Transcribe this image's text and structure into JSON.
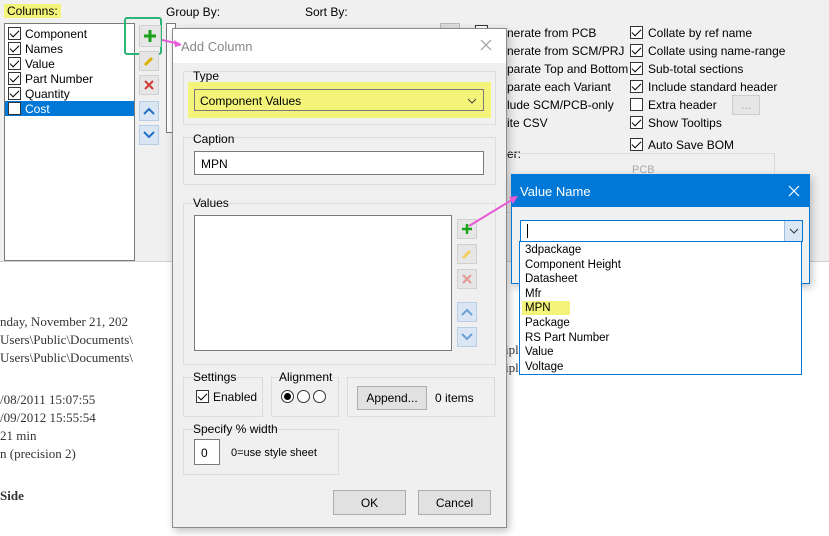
{
  "main_dialog": {
    "columns_label": "Columns:",
    "columns": [
      {
        "label": "Component",
        "checked": true,
        "selected": false
      },
      {
        "label": "Names",
        "checked": true,
        "selected": false
      },
      {
        "label": "Value",
        "checked": true,
        "selected": false
      },
      {
        "label": "Part Number",
        "checked": true,
        "selected": false
      },
      {
        "label": "Quantity",
        "checked": true,
        "selected": false
      },
      {
        "label": "Cost",
        "checked": false,
        "selected": true
      }
    ],
    "group_by_label": "Group By:",
    "sort_by_label": "Sort By:",
    "options": [
      {
        "label": "nerate from PCB",
        "checked": null
      },
      {
        "label": "nerate from SCM/PRJ",
        "checked": null
      },
      {
        "label": "parate Top and Bottom",
        "checked": null
      },
      {
        "label": "parate each Variant",
        "checked": null
      },
      {
        "label": "lude SCM/PCB-only",
        "checked": null
      },
      {
        "label": "ite CSV",
        "checked": null
      }
    ],
    "options_right": [
      {
        "label": "Collate by ref name",
        "checked": true
      },
      {
        "label": "Collate using name-range",
        "checked": true
      },
      {
        "label": "Sub-total sections",
        "checked": true
      },
      {
        "label": "Include standard header",
        "checked": true
      },
      {
        "label": "Extra header",
        "checked": false
      },
      {
        "label": "Show Tooltips",
        "checked": true
      },
      {
        "label": "Auto Save BOM",
        "checked": true
      }
    ],
    "extra_header_btn": "...",
    "filter_label": "er:",
    "pcb_label": "PCB"
  },
  "background_report": {
    "lines": [
      "nday, November 21, 202",
      "Users\\Public\\Documents\\",
      "Users\\Public\\Documents\\",
      "",
      "/08/2011 15:07:55",
      "/09/2012 15:55:54",
      "21 min",
      "n (precision 2)",
      "",
      "Side"
    ],
    "right_fragments": [
      "ipl",
      "ipl"
    ]
  },
  "add_column": {
    "title": "Add Column",
    "type_label": "Type",
    "type_value": "Component Values",
    "caption_label": "Caption",
    "caption_value": "MPN",
    "values_label": "Values",
    "settings_label": "Settings",
    "enabled_label": "Enabled",
    "alignment_label": "Alignment",
    "append_btn": "Append...",
    "items_count": "0 items",
    "width_label": "Specify % width",
    "width_value": "0",
    "width_hint": "0=use style sheet",
    "ok": "OK",
    "cancel": "Cancel"
  },
  "value_name": {
    "title": "Value Name",
    "input_value": "",
    "options": [
      "3dpackage",
      "Component Height",
      "Datasheet",
      "Mfr",
      "MPN",
      "Package",
      "RS Part Number",
      "Value",
      "Voltage"
    ],
    "highlighted": "MPN"
  },
  "colors": {
    "highlight": "#f4f47a",
    "selection": "#0078d7",
    "accent_green": "#2bb673",
    "arrow": "#e85ad6",
    "dialog_title_blue": "#0078d7"
  }
}
